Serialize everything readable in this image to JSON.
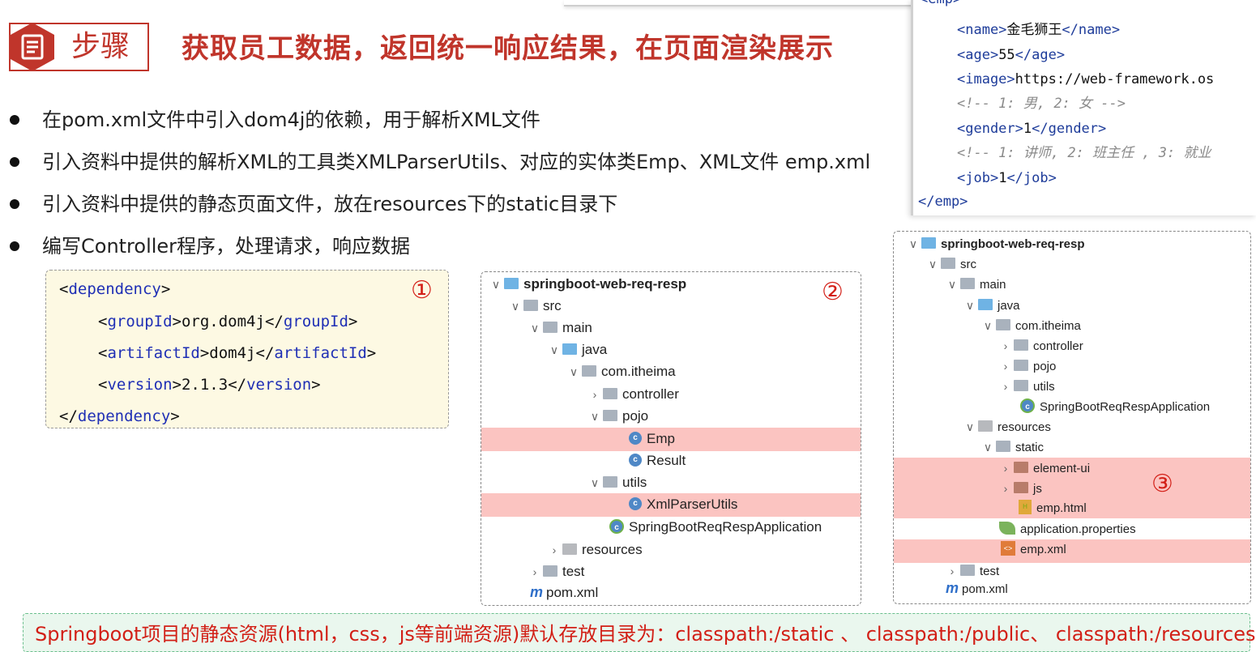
{
  "header": {
    "step_label": "步骤",
    "title": "获取员工数据，返回统一响应结果，在页面渲染展示"
  },
  "bullets": [
    "在pom.xml文件中引入dom4j的依赖，用于解析XML文件",
    "引入资料中提供的解析XML的工具类XMLParserUtils、对应的实体类Emp、XML文件 emp.xml",
    "引入资料中提供的静态页面文件，放在resources下的static目录下",
    "编写Controller程序，处理请求，响应数据"
  ],
  "xml_snippet": {
    "top_partial": "<emp>",
    "lines": [
      {
        "open": "<name>",
        "value": "金毛狮王",
        "close": "</name>"
      },
      {
        "open": "<age>",
        "value": "55",
        "close": "</age>"
      },
      {
        "open": "<image>",
        "value": "https://web-framework.os",
        "close": ""
      },
      {
        "comment": "<!-- 1: 男, 2: 女 -->"
      },
      {
        "open": "<gender>",
        "value": "1",
        "close": "</gender>"
      },
      {
        "comment": "<!-- 1: 讲师, 2: 班主任 , 3: 就业"
      },
      {
        "open": "<job>",
        "value": "1",
        "close": "</job>"
      }
    ],
    "end": "</emp>"
  },
  "dependency": {
    "marker": "①",
    "open": "dependency",
    "groupId": "org.dom4j",
    "artifactId": "dom4j",
    "version": "2.1.3",
    "close": "dependency",
    "tag_groupId": "groupId",
    "tag_artifactId": "artifactId",
    "tag_version": "version"
  },
  "tree2": {
    "marker": "②",
    "items": [
      "springboot-web-req-resp",
      "src",
      "main",
      "java",
      "com.itheima",
      "controller",
      "pojo",
      "Emp",
      "Result",
      "utils",
      "XmlParserUtils",
      "SpringBootReqRespApplication",
      "resources",
      "test",
      "pom.xml"
    ]
  },
  "tree3": {
    "marker": "③",
    "items": [
      "springboot-web-req-resp",
      "src",
      "main",
      "java",
      "com.itheima",
      "controller",
      "pojo",
      "utils",
      "SpringBootReqRespApplication",
      "resources",
      "static",
      "element-ui",
      "js",
      "emp.html",
      "application.properties",
      "emp.xml",
      "test",
      "pom.xml"
    ]
  },
  "footer": {
    "text": "Springboot项目的静态资源(html，css，js等前端资源)默认存放目录为：classpath:/static 、 classpath:/public、 classpath:/resources"
  },
  "colors": {
    "accent_red": "#c0352b",
    "highlight": "#fbc4c1",
    "dep_bg": "#fdf9e3",
    "footer_bg": "#eaf7ee"
  }
}
